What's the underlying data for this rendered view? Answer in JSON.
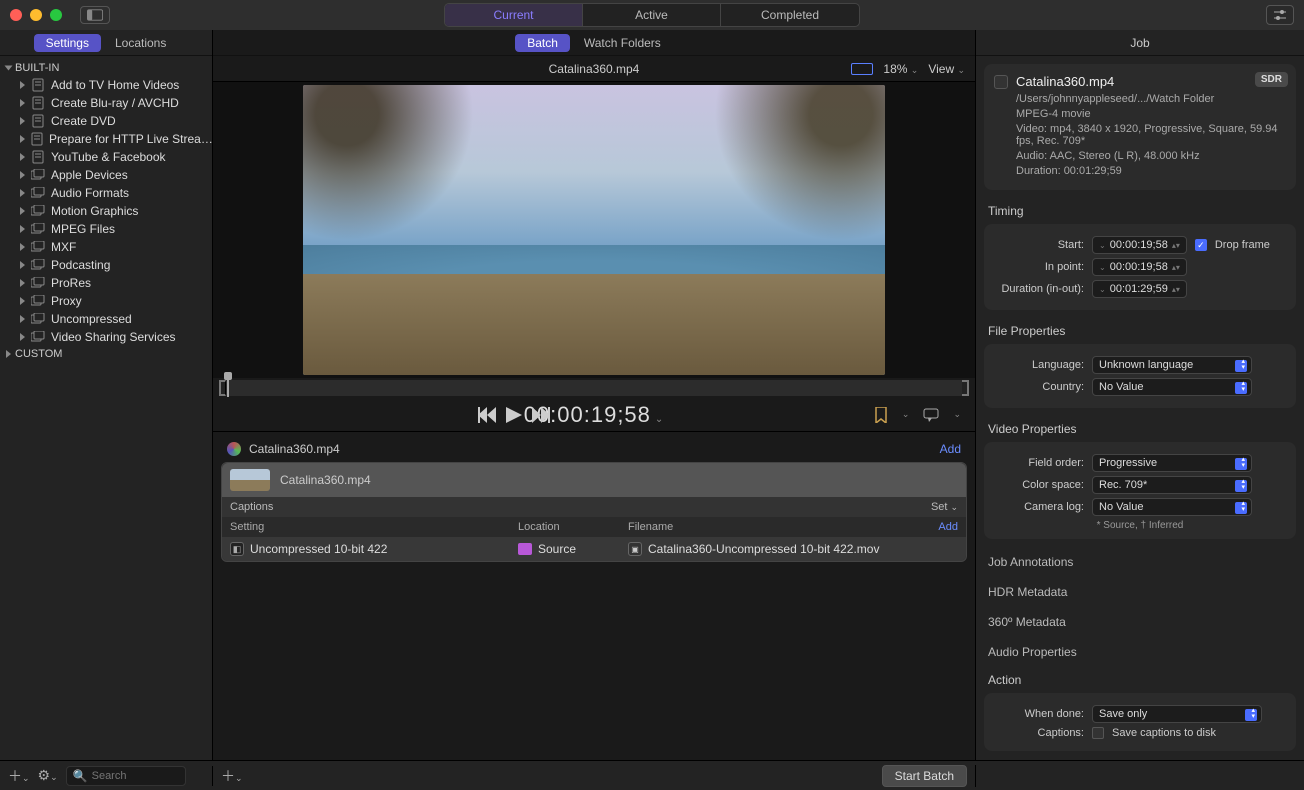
{
  "topTabs": {
    "current": "Current",
    "active": "Active",
    "completed": "Completed"
  },
  "leftTabs": {
    "settings": "Settings",
    "locations": "Locations"
  },
  "sidebar": {
    "builtin": "BUILT-IN",
    "custom": "CUSTOM",
    "items": [
      {
        "label": "Add to TV Home Videos",
        "doc": true
      },
      {
        "label": "Create Blu-ray / AVCHD",
        "doc": true
      },
      {
        "label": "Create DVD",
        "doc": true
      },
      {
        "label": "Prepare for HTTP Live Strea…",
        "doc": true
      },
      {
        "label": "YouTube & Facebook",
        "doc": true
      },
      {
        "label": "Apple Devices",
        "doc": false
      },
      {
        "label": "Audio Formats",
        "doc": false
      },
      {
        "label": "Motion Graphics",
        "doc": false
      },
      {
        "label": "MPEG Files",
        "doc": false
      },
      {
        "label": "MXF",
        "doc": false
      },
      {
        "label": "Podcasting",
        "doc": false
      },
      {
        "label": "ProRes",
        "doc": false
      },
      {
        "label": "Proxy",
        "doc": false
      },
      {
        "label": "Uncompressed",
        "doc": false
      },
      {
        "label": "Video Sharing Services",
        "doc": false
      }
    ]
  },
  "centerTabs": {
    "batch": "Batch",
    "watch": "Watch Folders"
  },
  "file": {
    "name": "Catalina360.mp4",
    "zoom": "18%",
    "view": "View"
  },
  "timecode": "00:00:19;58",
  "batchArea": {
    "jobName": "Catalina360.mp4",
    "add": "Add",
    "sourceRowName": "Catalina360.mp4",
    "captions": "Captions",
    "set": "Set",
    "headers": {
      "setting": "Setting",
      "location": "Location",
      "filename": "Filename",
      "add": "Add"
    },
    "out": {
      "setting": "Uncompressed 10-bit 422",
      "location": "Source",
      "filename": "Catalina360-Uncompressed 10-bit 422.mov"
    }
  },
  "inspector": {
    "title": "Job",
    "sdr": "SDR",
    "fname": "Catalina360.mp4",
    "path": "/Users/johnnyappleseed/.../Watch Folder",
    "format": "MPEG-4 movie",
    "video": "Video: mp4, 3840 x 1920, Progressive, Square, 59.94 fps, Rec. 709*",
    "audio": "Audio: AAC, Stereo (L R), 48.000 kHz",
    "duration": "Duration: 00:01:29;59",
    "timing": {
      "header": "Timing",
      "startL": "Start:",
      "startV": "00:00:19;58",
      "inL": "In point:",
      "inV": "00:00:19;58",
      "durL": "Duration (in-out):",
      "durV": "00:01:29;59",
      "drop": "Drop frame"
    },
    "fileProps": {
      "header": "File Properties",
      "langL": "Language:",
      "langV": "Unknown language",
      "countryL": "Country:",
      "countryV": "No Value"
    },
    "videoProps": {
      "header": "Video Properties",
      "fieldL": "Field order:",
      "fieldV": "Progressive",
      "colorL": "Color space:",
      "colorV": "Rec. 709*",
      "camL": "Camera log:",
      "camV": "No Value",
      "note": "* Source, † Inferred"
    },
    "sections": {
      "ja": "Job Annotations",
      "hdr": "HDR Metadata",
      "m360": "360º Metadata",
      "audio": "Audio Properties",
      "action": "Action"
    },
    "action": {
      "doneL": "When done:",
      "doneV": "Save only",
      "capL": "Captions:",
      "capV": "Save captions to disk"
    }
  },
  "footer": {
    "search": "Search",
    "start": "Start Batch"
  }
}
